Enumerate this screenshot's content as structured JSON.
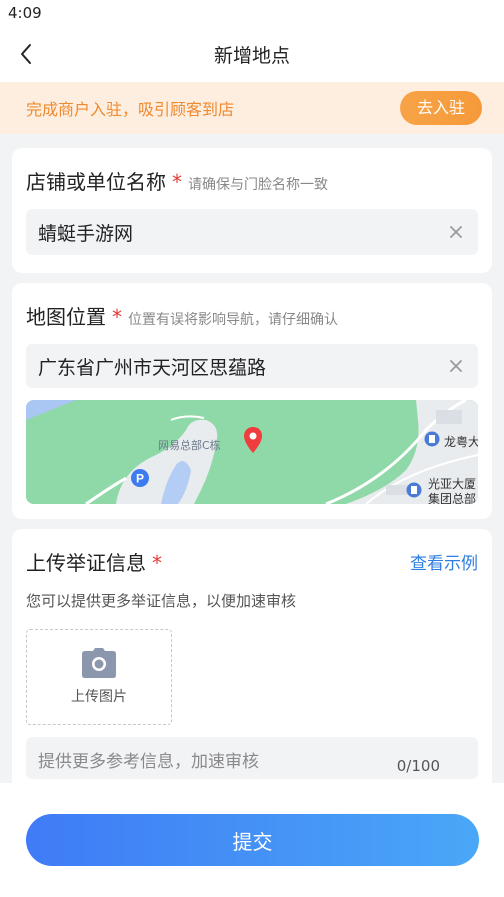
{
  "status_bar": {
    "time": "4:09"
  },
  "nav": {
    "title": "新增地点"
  },
  "promo": {
    "text": "完成商户入驻，吸引顾客到店",
    "button": "去入驻"
  },
  "shop_name": {
    "label": "店铺或单位名称",
    "required_mark": "*",
    "hint": "请确保与门脸名称一致",
    "value": "蜻蜓手游网"
  },
  "map_location": {
    "label": "地图位置",
    "required_mark": "*",
    "hint": "位置有误将影响导航，请仔细确认",
    "value": "广东省广州市天河区思蕴路",
    "map_labels": {
      "poi_main": "网易总部C栋",
      "poi_right_top": "龙粤大",
      "poi_right_bottom_1": "光亚大厦",
      "poi_right_bottom_2": "集团总部"
    }
  },
  "evidence": {
    "label": "上传举证信息",
    "required_mark": "*",
    "example_link": "查看示例",
    "description": "您可以提供更多举证信息，以便加速审核",
    "upload_label": "上传图片",
    "textarea_placeholder": "提供更多参考信息，加速审核",
    "counter": "0/100"
  },
  "submit": {
    "label": "提交"
  },
  "colors": {
    "accent_blue": "#3f7bf6",
    "promo_orange": "#f08a2e",
    "required_red": "#e53935",
    "map_green": "#8fd8a8"
  },
  "icons": {
    "back": "chevron-left-icon",
    "clear": "close-icon",
    "camera": "camera-icon",
    "pin": "map-pin-icon",
    "parking": "parking-icon",
    "building": "building-icon"
  }
}
